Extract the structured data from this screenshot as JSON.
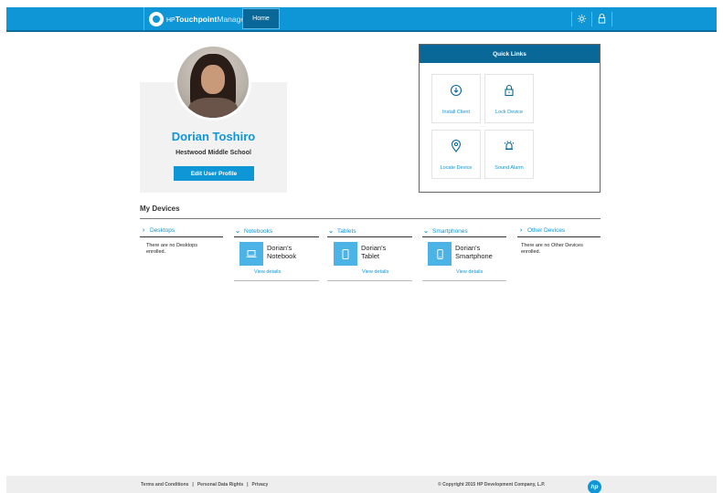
{
  "header": {
    "brand_hp": "HP",
    "brand_touchpoint": "Touchpoint",
    "brand_manager": "Manager",
    "home_tab": "Home",
    "icons": [
      "settings-gear-icon",
      "lock-icon"
    ],
    "accent_color": "#0f96d6"
  },
  "profile": {
    "name": "Dorian Toshiro",
    "school": "Hestwood Middle School",
    "edit_button": "Edit User Profile"
  },
  "quick_links": {
    "title": "Quick Links",
    "items": [
      {
        "label": "Install Client",
        "icon": "download-circle-icon"
      },
      {
        "label": "Lock Device",
        "icon": "padlock-icon"
      },
      {
        "label": "Locate Device",
        "icon": "location-pin-icon"
      },
      {
        "label": "Sound Alarm",
        "icon": "alarm-bell-icon"
      }
    ]
  },
  "devices": {
    "title": "My Devices",
    "columns": [
      {
        "label": "Desktops",
        "expanded": false,
        "empty_text": "There are no Desktops enrolled."
      },
      {
        "label": "Notebooks",
        "expanded": true,
        "device": "Dorian's Notebook",
        "link": "View details"
      },
      {
        "label": "Tablets",
        "expanded": true,
        "device": "Dorian's Tablet",
        "link": "View details"
      },
      {
        "label": "Smartphones",
        "expanded": true,
        "device": "Dorian's Smartphone",
        "link": "View details"
      },
      {
        "label": "Other Devices",
        "expanded": false,
        "empty_text": "There are no Other Devices enrolled."
      }
    ]
  },
  "footer": {
    "terms": "Terms and Conditions",
    "personal_data": "Personal Data Rights",
    "privacy": "Privacy",
    "separator": "|",
    "copyright": "© Copyright 2015 HP Development Company, L.P.",
    "logo_text": "hp"
  }
}
